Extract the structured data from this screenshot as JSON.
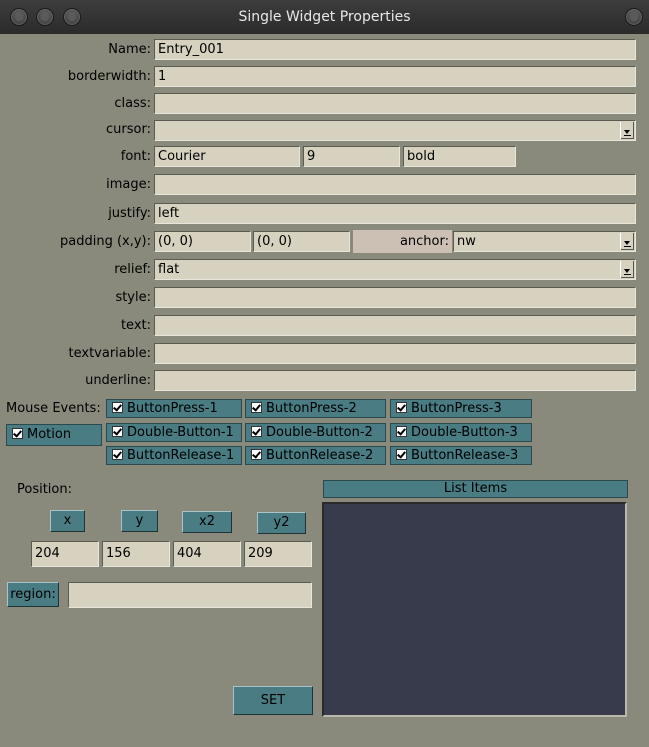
{
  "window": {
    "title": "Single Widget Properties"
  },
  "properties": {
    "name": {
      "label": "Name:",
      "value": "Entry_001"
    },
    "borderwidth": {
      "label": "borderwidth:",
      "value": "1"
    },
    "class": {
      "label": "class:",
      "value": ""
    },
    "cursor": {
      "label": "cursor:",
      "value": ""
    },
    "font": {
      "label": "font:",
      "family": "Courier",
      "size": "9",
      "weight": "bold"
    },
    "image": {
      "label": "image:",
      "value": ""
    },
    "justify": {
      "label": "justify:",
      "value": "left"
    },
    "padding": {
      "label": "padding (x,y):",
      "x": "(0, 0)",
      "y": "(0, 0)"
    },
    "anchor": {
      "label": "anchor:",
      "value": "nw"
    },
    "relief": {
      "label": "relief:",
      "value": "flat"
    },
    "style": {
      "label": "style:",
      "value": ""
    },
    "text": {
      "label": "text:",
      "value": ""
    },
    "textvariable": {
      "label": "textvariable:",
      "value": ""
    },
    "underline": {
      "label": "underline:",
      "value": ""
    }
  },
  "mouse_events": {
    "label": "Mouse Events:",
    "motion": {
      "label": "Motion",
      "checked": true
    },
    "buttons": [
      {
        "label": "ButtonPress-1",
        "checked": true
      },
      {
        "label": "ButtonPress-2",
        "checked": true
      },
      {
        "label": "ButtonPress-3",
        "checked": true
      },
      {
        "label": "Double-Button-1",
        "checked": true
      },
      {
        "label": "Double-Button-2",
        "checked": true
      },
      {
        "label": "Double-Button-3",
        "checked": true
      },
      {
        "label": "ButtonRelease-1",
        "checked": true
      },
      {
        "label": "ButtonRelease-2",
        "checked": true
      },
      {
        "label": "ButtonRelease-3",
        "checked": true
      }
    ]
  },
  "position": {
    "label": "Position:",
    "headers": [
      "x",
      "y",
      "x2",
      "y2"
    ],
    "values": [
      "204",
      "156",
      "404",
      "209"
    ],
    "region_label": "region:",
    "region_value": ""
  },
  "list_items": {
    "header": "List Items",
    "items": []
  },
  "set_button": "SET",
  "colors": {
    "background": "#898a7b",
    "field": "#d6d2bf",
    "button": "#497c83",
    "listbox": "#373b4b",
    "anchor_label_bg": "#ccc0b5"
  }
}
